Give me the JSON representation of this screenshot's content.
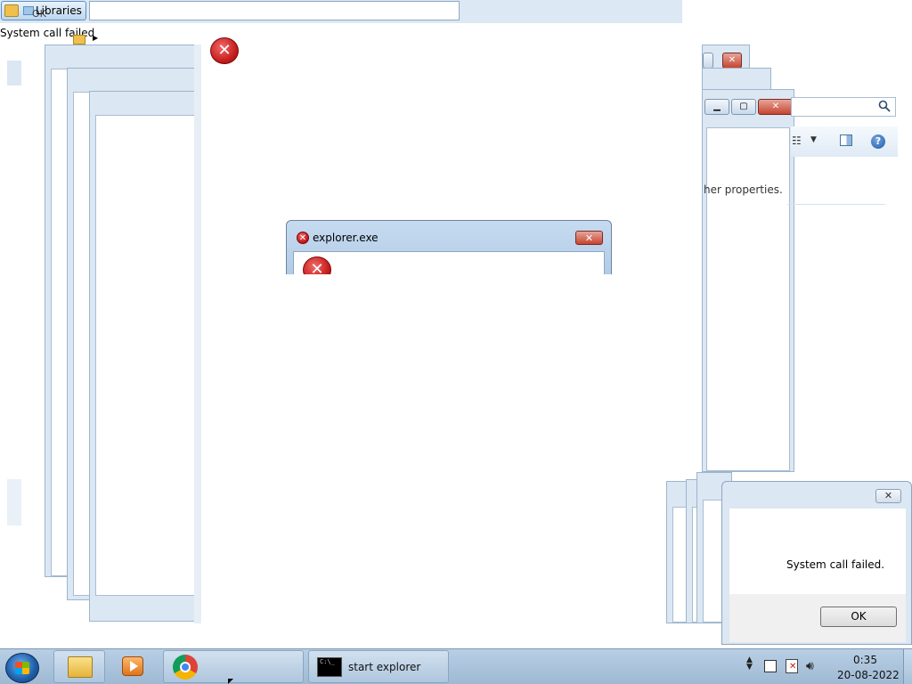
{
  "top": {
    "libraries_label": "Libraries",
    "ghost_ok": "OK",
    "system_call_failed": "System call failed"
  },
  "explorer_dialog": {
    "title": "explorer.exe",
    "close_glyph": "✕"
  },
  "right_window": {
    "properties_text": "her properties.",
    "help_glyph": "?"
  },
  "system_dialog": {
    "close_glyph": "✕",
    "message": "System call failed.",
    "ok_label": "OK"
  },
  "taskbar": {
    "cmd_label": "start  explorer",
    "cmd_icon_text": "C:\\_",
    "clock_time": "0:35",
    "clock_date": "20-08-2022"
  },
  "icons": {
    "error": "error-icon",
    "search": "search-icon",
    "help": "help-icon",
    "start": "windows-start-icon",
    "explorer": "folder-icon",
    "media": "media-player-icon",
    "chrome": "chrome-icon",
    "cmd": "command-prompt-icon"
  },
  "colors": {
    "error_red": "#c41a1a",
    "frame_blue": "#dbe7f3",
    "taskbar": "#b8cfe5"
  }
}
